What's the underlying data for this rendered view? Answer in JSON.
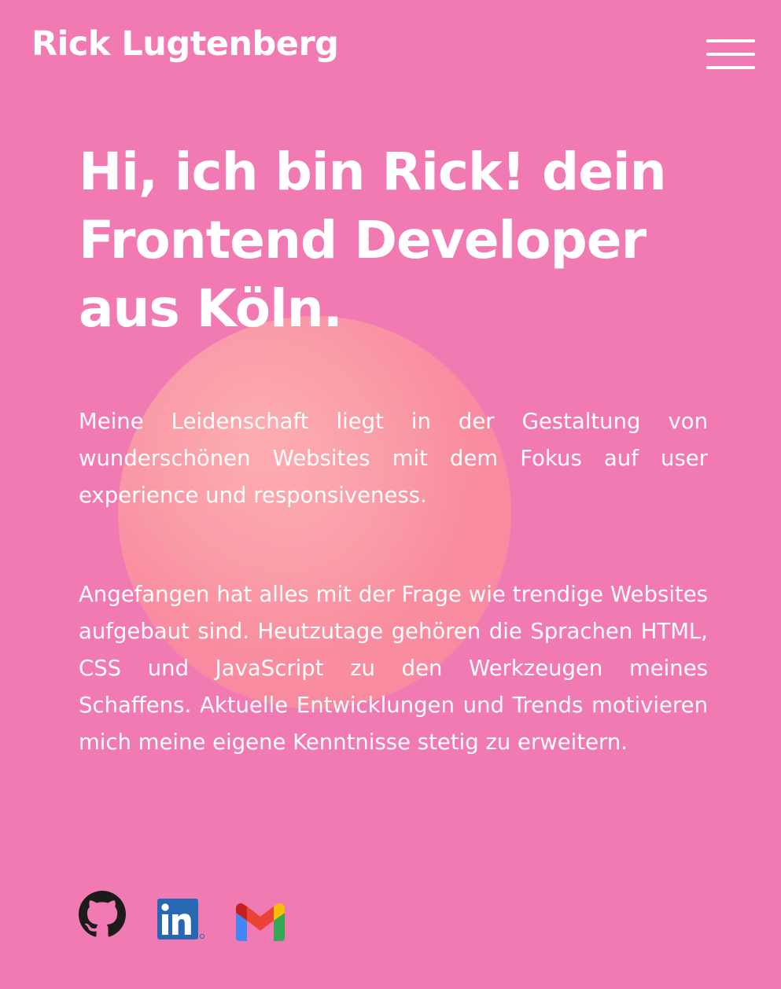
{
  "header": {
    "brand": "Rick Lugtenberg",
    "menu_icon": "hamburger-menu-icon"
  },
  "hero": {
    "title": "Hi, ich bin Rick! dein Frontend Developer aus Köln."
  },
  "about": {
    "paragraph_1": "Meine Leidenschaft liegt in der Gestaltung von wunderschönen Websites mit dem Fokus auf user experience und responsiveness.",
    "paragraph_2": "Angefangen hat alles mit der Frage wie trendige Websites aufgebaut sind. Heutzutage gehören die Sprachen HTML, CSS und JavaScript zu den Werkzeugen meines Schaffens. Aktuelle Entwicklungen und Trends motivieren mich meine eigene Kenntnisse stetig zu erweitern."
  },
  "socials": [
    {
      "icon": "github-icon"
    },
    {
      "icon": "linkedin-icon"
    },
    {
      "icon": "gmail-icon"
    }
  ],
  "colors": {
    "background": "#f27ab3",
    "orb": "#fa8e9e",
    "text": "#ffffff",
    "linkedin": "#2867b2"
  }
}
